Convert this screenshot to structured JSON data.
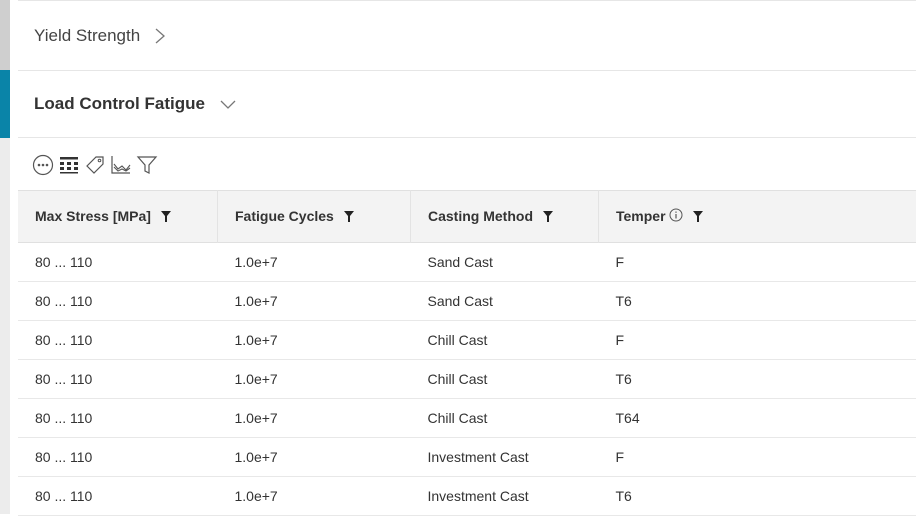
{
  "sections": {
    "yield_strength": {
      "label": "Yield Strength"
    },
    "load_control_fatigue": {
      "label": "Load Control Fatigue"
    }
  },
  "toolbar": {
    "icons": [
      "more-options-icon",
      "columns-icon",
      "tag-icon",
      "chart-icon",
      "filter-icon"
    ]
  },
  "table": {
    "headers": {
      "max_stress": "Max Stress [MPa]",
      "fatigue_cycles": "Fatigue Cycles",
      "casting_method": "Casting Method",
      "temper": "Temper"
    },
    "rows": [
      [
        "80 ... 110",
        "1.0e+7",
        "Sand Cast",
        "F"
      ],
      [
        "80 ... 110",
        "1.0e+7",
        "Sand Cast",
        "T6"
      ],
      [
        "80 ... 110",
        "1.0e+7",
        "Chill Cast",
        "F"
      ],
      [
        "80 ... 110",
        "1.0e+7",
        "Chill Cast",
        "T6"
      ],
      [
        "80 ... 110",
        "1.0e+7",
        "Chill Cast",
        "T64"
      ],
      [
        "80 ... 110",
        "1.0e+7",
        "Investment Cast",
        "F"
      ],
      [
        "80 ... 110",
        "1.0e+7",
        "Investment Cast",
        "T6"
      ]
    ]
  },
  "colors": {
    "accent": "#0a84a8",
    "header_bg": "#f3f3f3"
  }
}
